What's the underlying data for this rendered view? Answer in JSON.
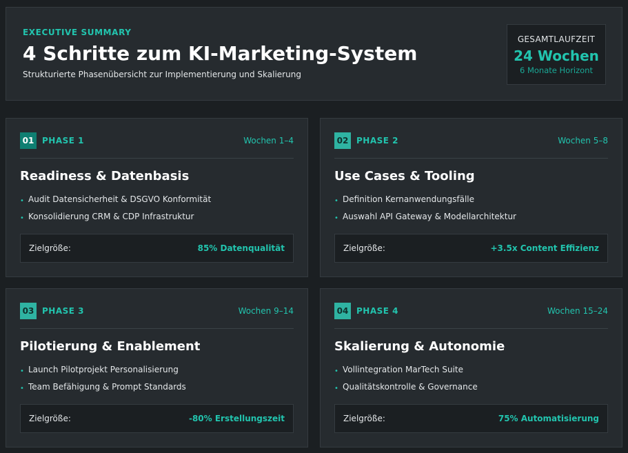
{
  "summary": {
    "eyebrow": "EXECUTIVE SUMMARY",
    "title": "4 Schritte zum KI-Marketing-System",
    "subtitle": "Strukturierte Phasenübersicht zur Implementierung und Skalierung",
    "duration": {
      "label": "GESAMTLAUFZEIT",
      "value": "24 Wochen",
      "sub": "6 Monate Horizont"
    }
  },
  "phases": [
    {
      "number": "01",
      "label": "PHASE 1",
      "weeks": "Wochen 1–4",
      "title": "Readiness & Datenbasis",
      "bullets": [
        "Audit Datensicherheit & DSGVO Konformität",
        "Konsolidierung CRM & CDP Infrastruktur"
      ],
      "kpi_label": "Zielgröße:",
      "kpi_value": "85% Datenqualität"
    },
    {
      "number": "02",
      "label": "PHASE 2",
      "weeks": "Wochen 5–8",
      "title": "Use Cases & Tooling",
      "bullets": [
        "Definition Kernanwendungsfälle",
        "Auswahl API Gateway & Modellarchitektur"
      ],
      "kpi_label": "Zielgröße:",
      "kpi_value": "+3.5x Content Effizienz"
    },
    {
      "number": "03",
      "label": "PHASE 3",
      "weeks": "Wochen 9–14",
      "title": "Pilotierung & Enablement",
      "bullets": [
        "Launch Pilotprojekt Personalisierung",
        "Team Befähigung & Prompt Standards"
      ],
      "kpi_label": "Zielgröße:",
      "kpi_value": "-80% Erstellungszeit"
    },
    {
      "number": "04",
      "label": "PHASE 4",
      "weeks": "Wochen 15–24",
      "title": "Skalierung & Autonomie",
      "bullets": [
        "Vollintegration MarTech Suite",
        "Qualitätskontrolle & Governance"
      ],
      "kpi_label": "Zielgröße:",
      "kpi_value": "75% Automatisierung"
    }
  ],
  "colors": {
    "background": "#1b1f22",
    "card": "#262b2f",
    "accent": "#22c4ae",
    "badge_dark": "#0f7f72",
    "badge_light": "#2fb3a2"
  }
}
